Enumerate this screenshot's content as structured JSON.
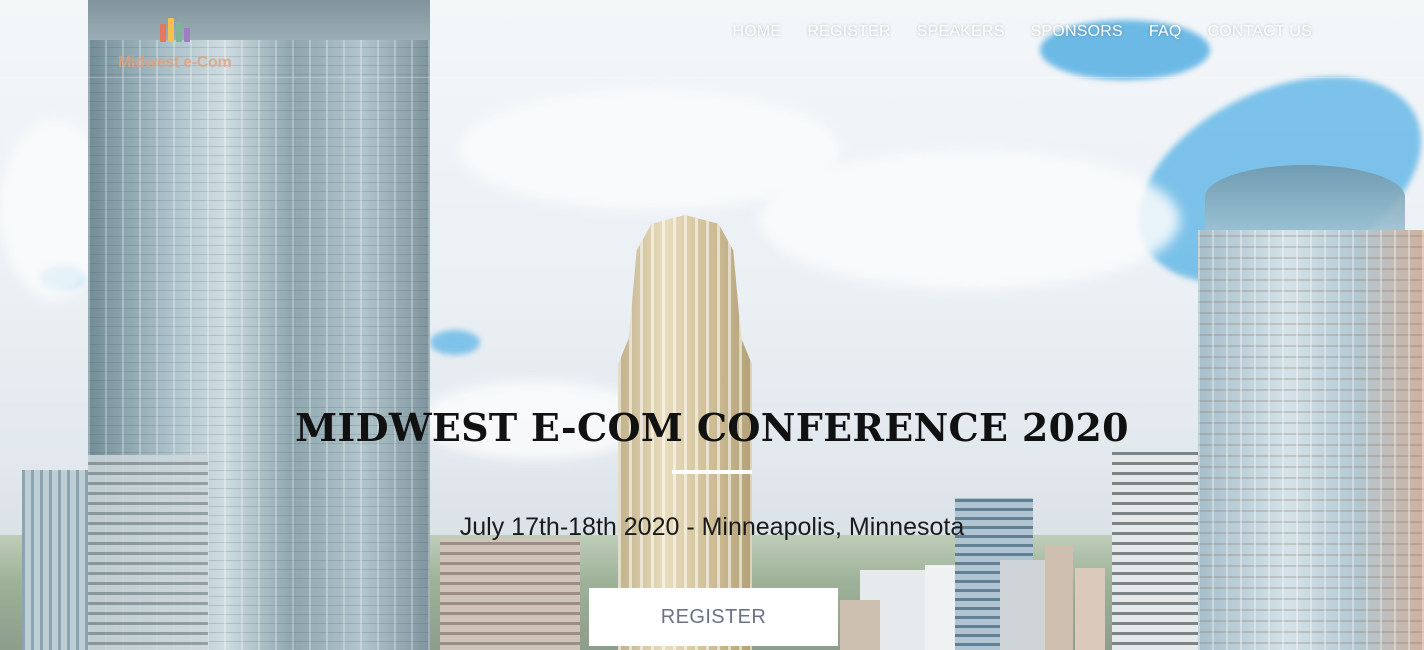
{
  "nav": {
    "logo_text": "Midwest e-Com",
    "items": [
      {
        "label": "HOME"
      },
      {
        "label": "REGISTER"
      },
      {
        "label": "SPEAKERS"
      },
      {
        "label": "SPONSORS"
      },
      {
        "label": "FAQ"
      },
      {
        "label": "CONTACT US"
      }
    ]
  },
  "hero": {
    "title": "MIDWEST E-COM CONFERENCE 2020",
    "subtitle": "July 17th-18th 2020 - Minneapolis, Minnesota",
    "cta_label": "REGISTER",
    "background": "minneapolis-skyline-photo"
  },
  "colors": {
    "nav_text": "#ffffff",
    "title": "#111111",
    "cta_background": "#ffffff",
    "cta_text": "#6a7286",
    "sky_accent": "#3ea7e3"
  }
}
